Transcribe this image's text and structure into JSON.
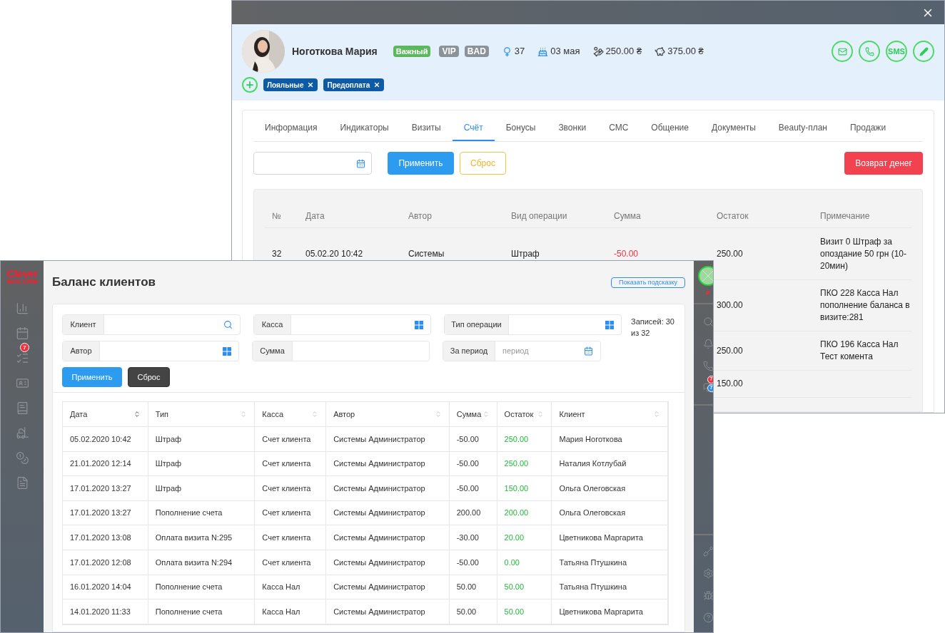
{
  "client_window": {
    "client": {
      "name": "Ноготкова Мария",
      "badges": [
        {
          "label": "Важный",
          "color": "#5cb85c"
        },
        {
          "label": "VIP",
          "color": "#8b9299"
        },
        {
          "label": "BAD",
          "color": "#8b9299"
        }
      ],
      "stats": [
        {
          "kind": "gender",
          "text": "37"
        },
        {
          "kind": "birthday",
          "text": "03 мая"
        },
        {
          "kind": "money",
          "text": "250.00 ₴"
        },
        {
          "kind": "savings",
          "text": "375.00 ₴"
        }
      ],
      "actions": [
        {
          "kind": "mail"
        },
        {
          "kind": "phone"
        },
        {
          "kind": "sms",
          "label": "SMS"
        },
        {
          "kind": "edit"
        }
      ],
      "tags": [
        {
          "label": "Лояльные"
        },
        {
          "label": "Предоплата"
        }
      ]
    },
    "tabs": [
      {
        "label": "Информация",
        "selected": false
      },
      {
        "label": "Индикаторы",
        "selected": false
      },
      {
        "label": "Визиты",
        "selected": false
      },
      {
        "label": "Счёт",
        "selected": true
      },
      {
        "label": "Бонусы",
        "selected": false
      },
      {
        "label": "Звонки",
        "selected": false
      },
      {
        "label": "СМС",
        "selected": false
      },
      {
        "label": "Общение",
        "selected": false
      },
      {
        "label": "Документы",
        "selected": false
      },
      {
        "label": "Beauty-план",
        "selected": false
      },
      {
        "label": "Продажи",
        "selected": false
      }
    ],
    "apply": "Применить",
    "reset": "Сброс",
    "refund": "Возврат денег",
    "table": {
      "columns": [
        "№",
        "Дата",
        "Автор",
        "Вид операции",
        "Сумма",
        "Остаток",
        "Примечание"
      ],
      "rows": [
        {
          "number": "32",
          "date": "05.02.20 10:42",
          "author": "Системы",
          "operation": "Штраф",
          "amount": "-50.00",
          "balance": "250.00",
          "note": "Визит 0 Штраф за опоздание 50 грн (10-20мин)"
        },
        {
          "balance": "300.00",
          "note": "ПКО 228 Касса Нал пополнение баланса в визите:281"
        },
        {
          "balance": "250.00",
          "note": "ПКО 196 Касса Нал Тест комента"
        },
        {
          "balance": "150.00"
        }
      ]
    }
  },
  "app": {
    "logo": {
      "top": "Clever",
      "bottom": "BOX:CRM"
    },
    "nav": [
      {
        "kind": "chart"
      },
      {
        "kind": "calendar"
      },
      {
        "kind": "tasks",
        "badge": "7"
      },
      {
        "kind": "contact"
      },
      {
        "kind": "book"
      },
      {
        "kind": "forklift"
      },
      {
        "kind": "coins"
      },
      {
        "kind": "document"
      }
    ],
    "title": "Баланс клиентов",
    "hint_button": "Показать подсказку",
    "filters": [
      {
        "label": "Клиент",
        "kind": "search"
      },
      {
        "label": "Касса",
        "kind": "select"
      },
      {
        "label": "Тип операции",
        "kind": "select"
      },
      {
        "label": "Автор",
        "kind": "select"
      },
      {
        "label": "Сумма",
        "kind": "text"
      },
      {
        "label": "За период",
        "placeholder": "период",
        "kind": "date"
      }
    ],
    "records": "Записей: 30 из 32",
    "apply": "Применить",
    "reset": "Сброс",
    "table": {
      "columns": [
        {
          "label": "Дата",
          "sorted": true
        },
        {
          "label": "Тип",
          "sorted": false
        },
        {
          "label": "Касса",
          "sorted": false
        },
        {
          "label": "Автор",
          "sorted": false
        },
        {
          "label": "Сумма",
          "sorted": false
        },
        {
          "label": "Остаток",
          "sorted": false
        },
        {
          "label": "Клиент",
          "sorted": false
        }
      ],
      "rows": [
        [
          "05.02.2020 10:42",
          "Штраф",
          "Счет клиента",
          "Системы Администратор",
          "-50.00",
          "250.00",
          "Мария Ноготкова"
        ],
        [
          "21.01.2020 12:14",
          "Штраф",
          "Счет клиента",
          "Системы Администратор",
          "-50.00",
          "250.00",
          "Наталия Котлубай"
        ],
        [
          "17.01.2020 13:27",
          "Штраф",
          "Счет клиента",
          "Системы Администратор",
          "-50.00",
          "150.00",
          "Ольга Олеговская"
        ],
        [
          "17.01.2020 13:27",
          "Пополнение счета",
          "Счет клиента",
          "Системы Администратор",
          "200.00",
          "200.00",
          "Ольга Олеговская"
        ],
        [
          "17.01.2020 13:08",
          "Оплата визита N:295",
          "Счет клиента",
          "Системы Администратор",
          "-30.00",
          "20.00",
          "Цветникова Маргарита"
        ],
        [
          "17.01.2020 12:08",
          "Оплата визита N:294",
          "Счет клиента",
          "Системы Администратор",
          "-50.00",
          "0.00",
          "Татьяна Птушкина"
        ],
        [
          "16.01.2020 14:04",
          "Пополнение счета",
          "Касса Нал",
          "Системы Администратор",
          "50.00",
          "50.00",
          "Татьяна Птушкина"
        ],
        [
          "14.01.2020 11:33",
          "Пополнение счета",
          "Касса Нал",
          "Системы Администратор",
          "50.00",
          "50.00",
          "Цветникова Маргарита"
        ]
      ]
    },
    "user": {
      "status": "P"
    },
    "tools": [
      {
        "kind": "search"
      },
      {
        "kind": "bell"
      },
      {
        "kind": "phone"
      },
      {
        "kind": "chat",
        "badges": [
          {
            "text": "7",
            "color": "#f0313f"
          },
          {
            "text": "7",
            "color": "#2d8cf0"
          }
        ]
      }
    ],
    "bottom_tools": [
      {
        "kind": "shovel"
      },
      {
        "kind": "settings"
      },
      {
        "kind": "bug"
      },
      {
        "kind": "help"
      }
    ]
  }
}
